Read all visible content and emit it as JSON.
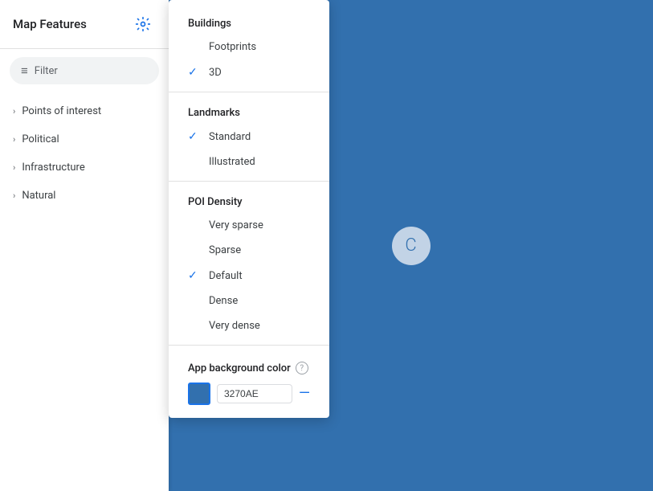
{
  "sidebar": {
    "title": "Map Features",
    "filter_placeholder": "Filter",
    "nav_items": [
      {
        "label": "Points of interest"
      },
      {
        "label": "Political"
      },
      {
        "label": "Infrastructure"
      },
      {
        "label": "Natural"
      }
    ]
  },
  "dropdown": {
    "sections": [
      {
        "title": "Buildings",
        "items": [
          {
            "label": "Footprints",
            "checked": false
          },
          {
            "label": "3D",
            "checked": true
          }
        ]
      },
      {
        "title": "Landmarks",
        "items": [
          {
            "label": "Standard",
            "checked": true
          },
          {
            "label": "Illustrated",
            "checked": false
          }
        ]
      },
      {
        "title": "POI Density",
        "items": [
          {
            "label": "Very sparse",
            "checked": false
          },
          {
            "label": "Sparse",
            "checked": false
          },
          {
            "label": "Default",
            "checked": true
          },
          {
            "label": "Dense",
            "checked": false
          },
          {
            "label": "Very dense",
            "checked": false
          }
        ]
      }
    ],
    "app_bg_color": {
      "label": "App background color",
      "value": "3270AE",
      "color_hex": "#3270ae"
    }
  },
  "icons": {
    "gear": "⚙",
    "filter_lines": "≡",
    "chevron_right": "›",
    "check": "✓",
    "question": "?",
    "dash": "—",
    "loading": "C"
  }
}
